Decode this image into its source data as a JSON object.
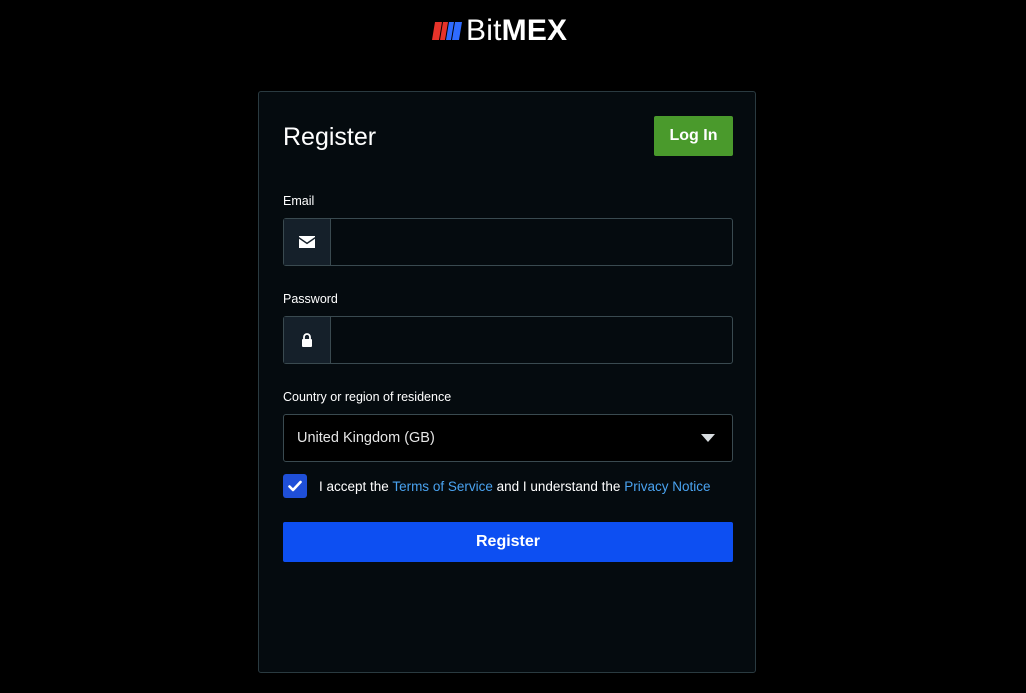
{
  "brand": {
    "name_part1": "Bit",
    "name_part2": "MEX",
    "logo_colors": [
      "#e6332a",
      "#2f6bff"
    ]
  },
  "card": {
    "title": "Register",
    "login_label": "Log In"
  },
  "form": {
    "email": {
      "label": "Email",
      "value": "",
      "icon": "envelope-icon"
    },
    "password": {
      "label": "Password",
      "value": "",
      "icon": "lock-icon"
    },
    "country": {
      "label": "Country or region of residence",
      "selected": "United Kingdom (GB)",
      "icon": "chevron-down-icon"
    },
    "terms": {
      "checked": true,
      "text_before": "I accept the ",
      "link_terms": "Terms of Service",
      "text_middle": " and I understand the ",
      "link_privacy": "Privacy Notice"
    },
    "register_label": "Register"
  },
  "colors": {
    "accent_blue": "#0d4ff2",
    "login_green": "#4a9a2c",
    "link_blue": "#4aa3f0"
  }
}
